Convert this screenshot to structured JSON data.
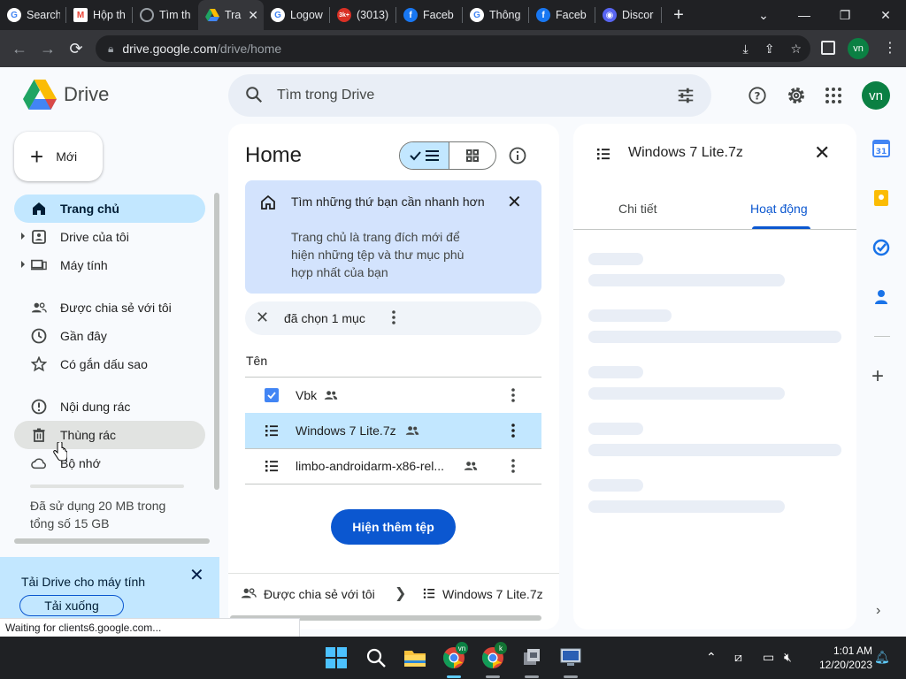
{
  "browser": {
    "tabs": [
      {
        "title": "Search",
        "favicon": "google-icon",
        "color": "#4285f4"
      },
      {
        "title": "Hộp th",
        "favicon": "gmail-icon",
        "color": "#ea4335"
      },
      {
        "title": "Tìm th",
        "favicon": "globe-icon",
        "color": "#9aa0a6"
      },
      {
        "title": "Tra",
        "favicon": "drive-icon",
        "color": "#1fa463",
        "active": true
      },
      {
        "title": "Logow",
        "favicon": "google-icon",
        "color": "#4285f4"
      },
      {
        "title": "(3013)",
        "favicon": "badge-icon",
        "color": "#d93025",
        "badge": "3k+"
      },
      {
        "title": "Faceb",
        "favicon": "facebook-icon",
        "color": "#1877f2"
      },
      {
        "title": "Thông",
        "favicon": "google-icon",
        "color": "#4285f4"
      },
      {
        "title": "Faceb",
        "favicon": "facebook-icon",
        "color": "#1877f2"
      },
      {
        "title": "Discor",
        "favicon": "discord-icon",
        "color": "#5865f2"
      }
    ],
    "url_host": "drive.google.com",
    "url_path": "/drive/home",
    "profile_initials": "vn"
  },
  "drive": {
    "app_name": "Drive",
    "search_placeholder": "Tìm trong Drive",
    "avatar_initials": "vn",
    "new_label": "Mới",
    "nav": [
      {
        "label": "Trang chủ",
        "icon": "home-icon",
        "active": true
      },
      {
        "label": "Drive của tôi",
        "icon": "my-drive-icon",
        "caret": true
      },
      {
        "label": "Máy tính",
        "icon": "computer-icon",
        "caret": true
      },
      {
        "label": "Được chia sẻ với tôi",
        "icon": "shared-people-icon"
      },
      {
        "label": "Gần đây",
        "icon": "clock-icon"
      },
      {
        "label": "Có gắn dấu sao",
        "icon": "star-icon"
      },
      {
        "label": "Nội dung rác",
        "icon": "spam-icon"
      },
      {
        "label": "Thùng rác",
        "icon": "trash-icon",
        "hover": true
      },
      {
        "label": "Bộ nhớ",
        "icon": "cloud-icon"
      }
    ],
    "storage_text": "Đã sử dụng 20 MB trong tổng số 15 GB",
    "download_banner": {
      "title": "Tải Drive cho máy tính",
      "button": "Tải xuống"
    }
  },
  "main": {
    "title": "Home",
    "tip": {
      "title": "Tìm những thứ bạn cần nhanh hơn",
      "body": "Trang chủ là trang đích mới để hiện những tệp và thư mục phù hợp nhất của bạn"
    },
    "selection_text": "đã chọn 1 mục",
    "column_name": "Tên",
    "files": [
      {
        "name": "Vbk",
        "icon": "checkbox-doc-icon",
        "shared": true,
        "selected": false
      },
      {
        "name": "Windows 7 Lite.7z",
        "icon": "archive-icon",
        "shared": true,
        "selected": true
      },
      {
        "name": "limbo-androidarm-x86-rel...",
        "icon": "archive-icon",
        "shared": true,
        "selected": false
      }
    ],
    "show_more": "Hiện thêm tệp",
    "breadcrumb": {
      "first": "Được chia sẻ với tôi",
      "second": "Windows 7 Lite.7z"
    }
  },
  "details": {
    "title": "Windows 7 Lite.7z",
    "tabs": [
      {
        "label": "Chi tiết",
        "active": false
      },
      {
        "label": "Hoạt động",
        "active": true
      }
    ]
  },
  "status_text": "Waiting for clients6.google.com...",
  "taskbar": {
    "time": "1:01 AM",
    "date": "12/20/2023",
    "chrome_badge_1": "vn",
    "chrome_badge_2": "k"
  }
}
